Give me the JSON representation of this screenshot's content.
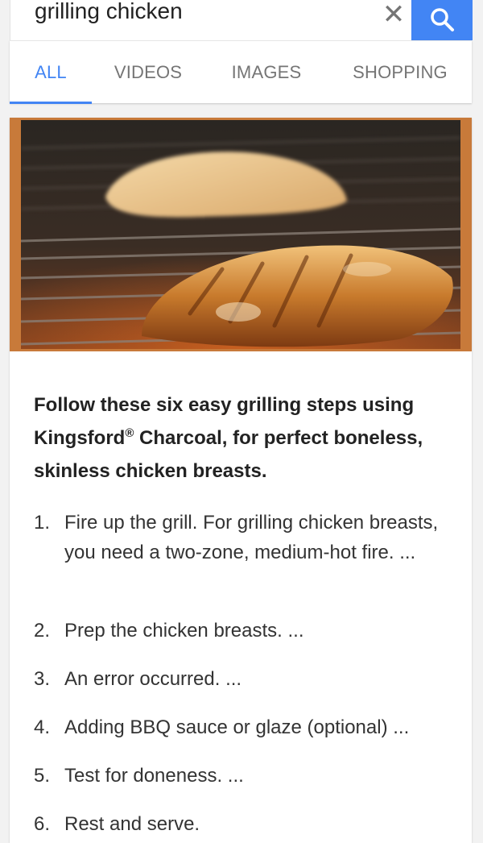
{
  "search": {
    "query": "grilling chicken",
    "clear_icon": "close-icon",
    "search_icon": "search-icon"
  },
  "tabs": [
    {
      "label": "ALL",
      "active": true
    },
    {
      "label": "VIDEOS",
      "active": false
    },
    {
      "label": "IMAGES",
      "active": false
    },
    {
      "label": "SHOPPING",
      "active": false
    }
  ],
  "colors": {
    "accent": "#4285f4",
    "hero_border": "#c87a3a"
  },
  "card": {
    "intro_before_mark": "Follow these six easy grilling steps using Kingsford",
    "registered_mark": "®",
    "intro_after_mark": " Charcoal, for perfect boneless, skinless chicken breasts.",
    "steps": [
      {
        "num": "1.",
        "text": "Fire up the grill. For grilling chicken breasts, you need a two-zone, medium-hot fire. ..."
      },
      {
        "num": "2.",
        "text": "Prep the chicken breasts. ..."
      },
      {
        "num": "3.",
        "text": "An error occurred. ..."
      },
      {
        "num": "4.",
        "text": "Adding BBQ sauce or glaze (optional) ..."
      },
      {
        "num": "5.",
        "text": "Test for doneness. ..."
      },
      {
        "num": "6.",
        "text": "Rest and serve."
      }
    ]
  }
}
